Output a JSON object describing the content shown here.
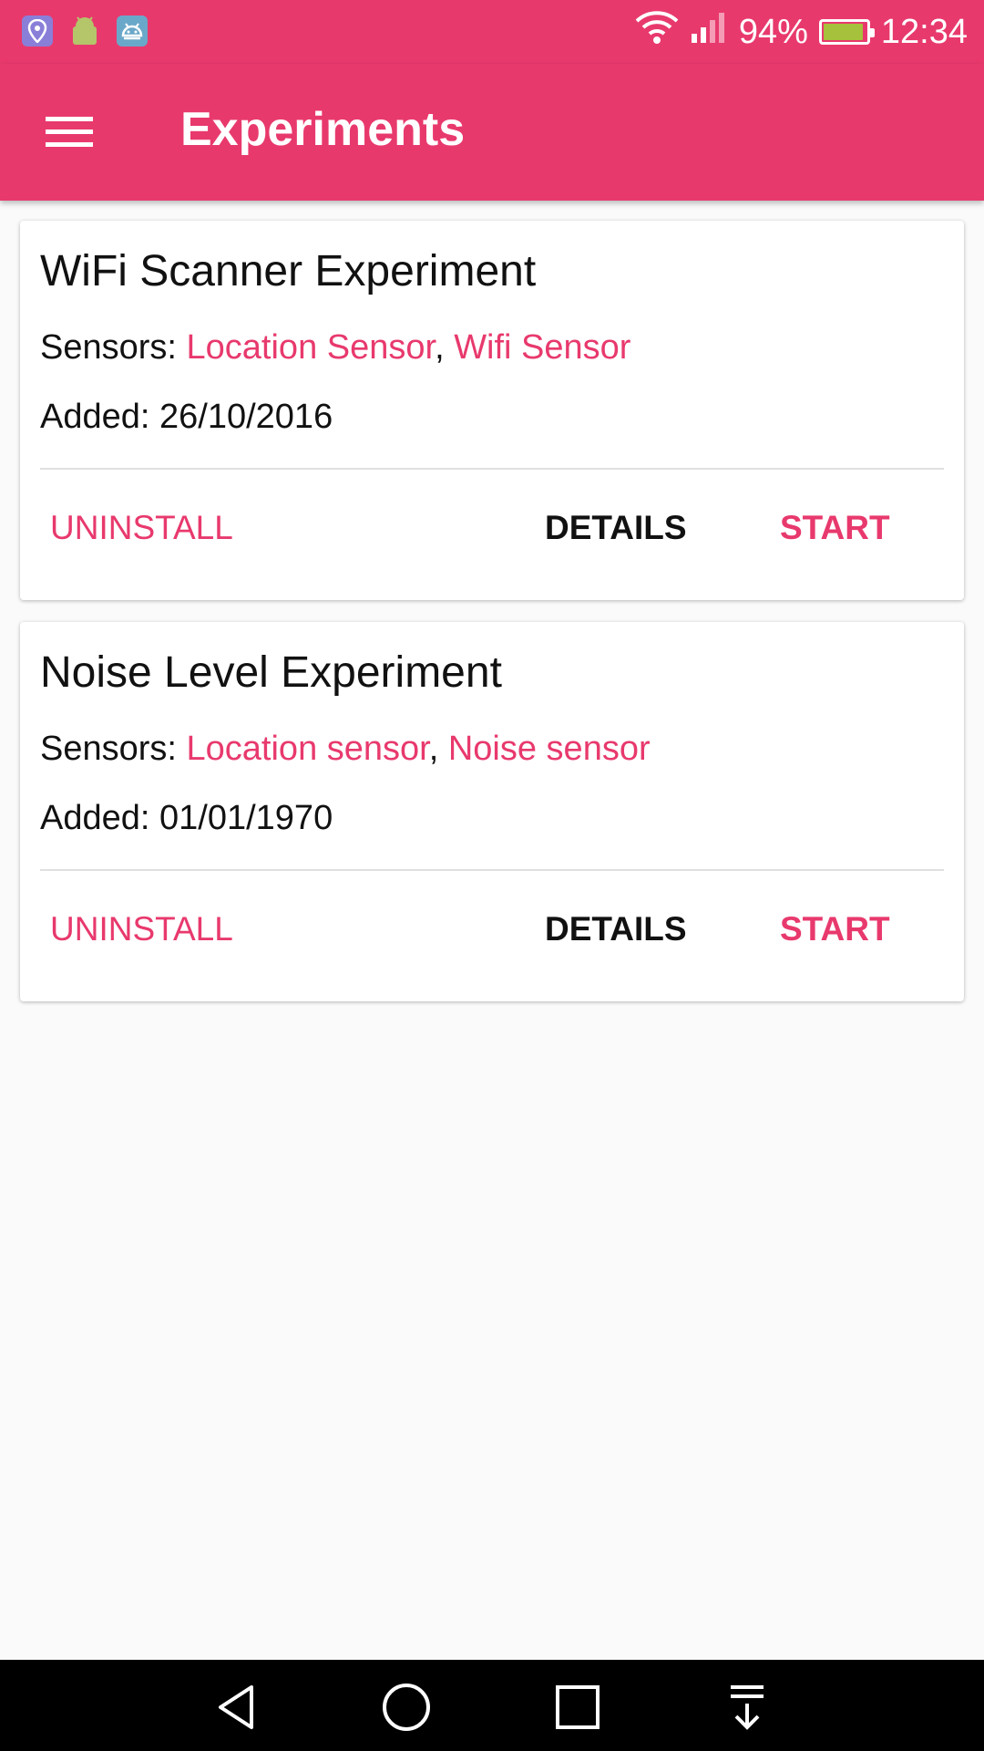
{
  "status_bar": {
    "notification_icons": [
      "location-app-icon",
      "android-icon",
      "android-robot-icon"
    ],
    "battery": "94%",
    "battery_level": 0.94,
    "time": "12:34"
  },
  "app_bar": {
    "title": "Experiments"
  },
  "experiments": [
    {
      "title": "WiFi Scanner Experiment",
      "sensors_label": "Sensors:",
      "sensors": [
        "Location Sensor",
        "Wifi Sensor"
      ],
      "separator": ",",
      "added_label": "Added:",
      "added": "26/10/2016",
      "actions": {
        "uninstall": "UNINSTALL",
        "details": "DETAILS",
        "start": "START"
      }
    },
    {
      "title": "Noise Level Experiment",
      "sensors_label": "Sensors:",
      "sensors": [
        "Location sensor",
        "Noise sensor"
      ],
      "separator": ",",
      "added_label": "Added:",
      "added": "01/01/1970",
      "actions": {
        "uninstall": "UNINSTALL",
        "details": "DETAILS",
        "start": "START"
      }
    }
  ],
  "colors": {
    "primary": "#e8396d",
    "text": "#111111",
    "background": "#fafafa"
  },
  "nav_bar": {
    "buttons": [
      "back-icon",
      "home-icon",
      "recents-icon",
      "notification-pull-icon"
    ]
  }
}
